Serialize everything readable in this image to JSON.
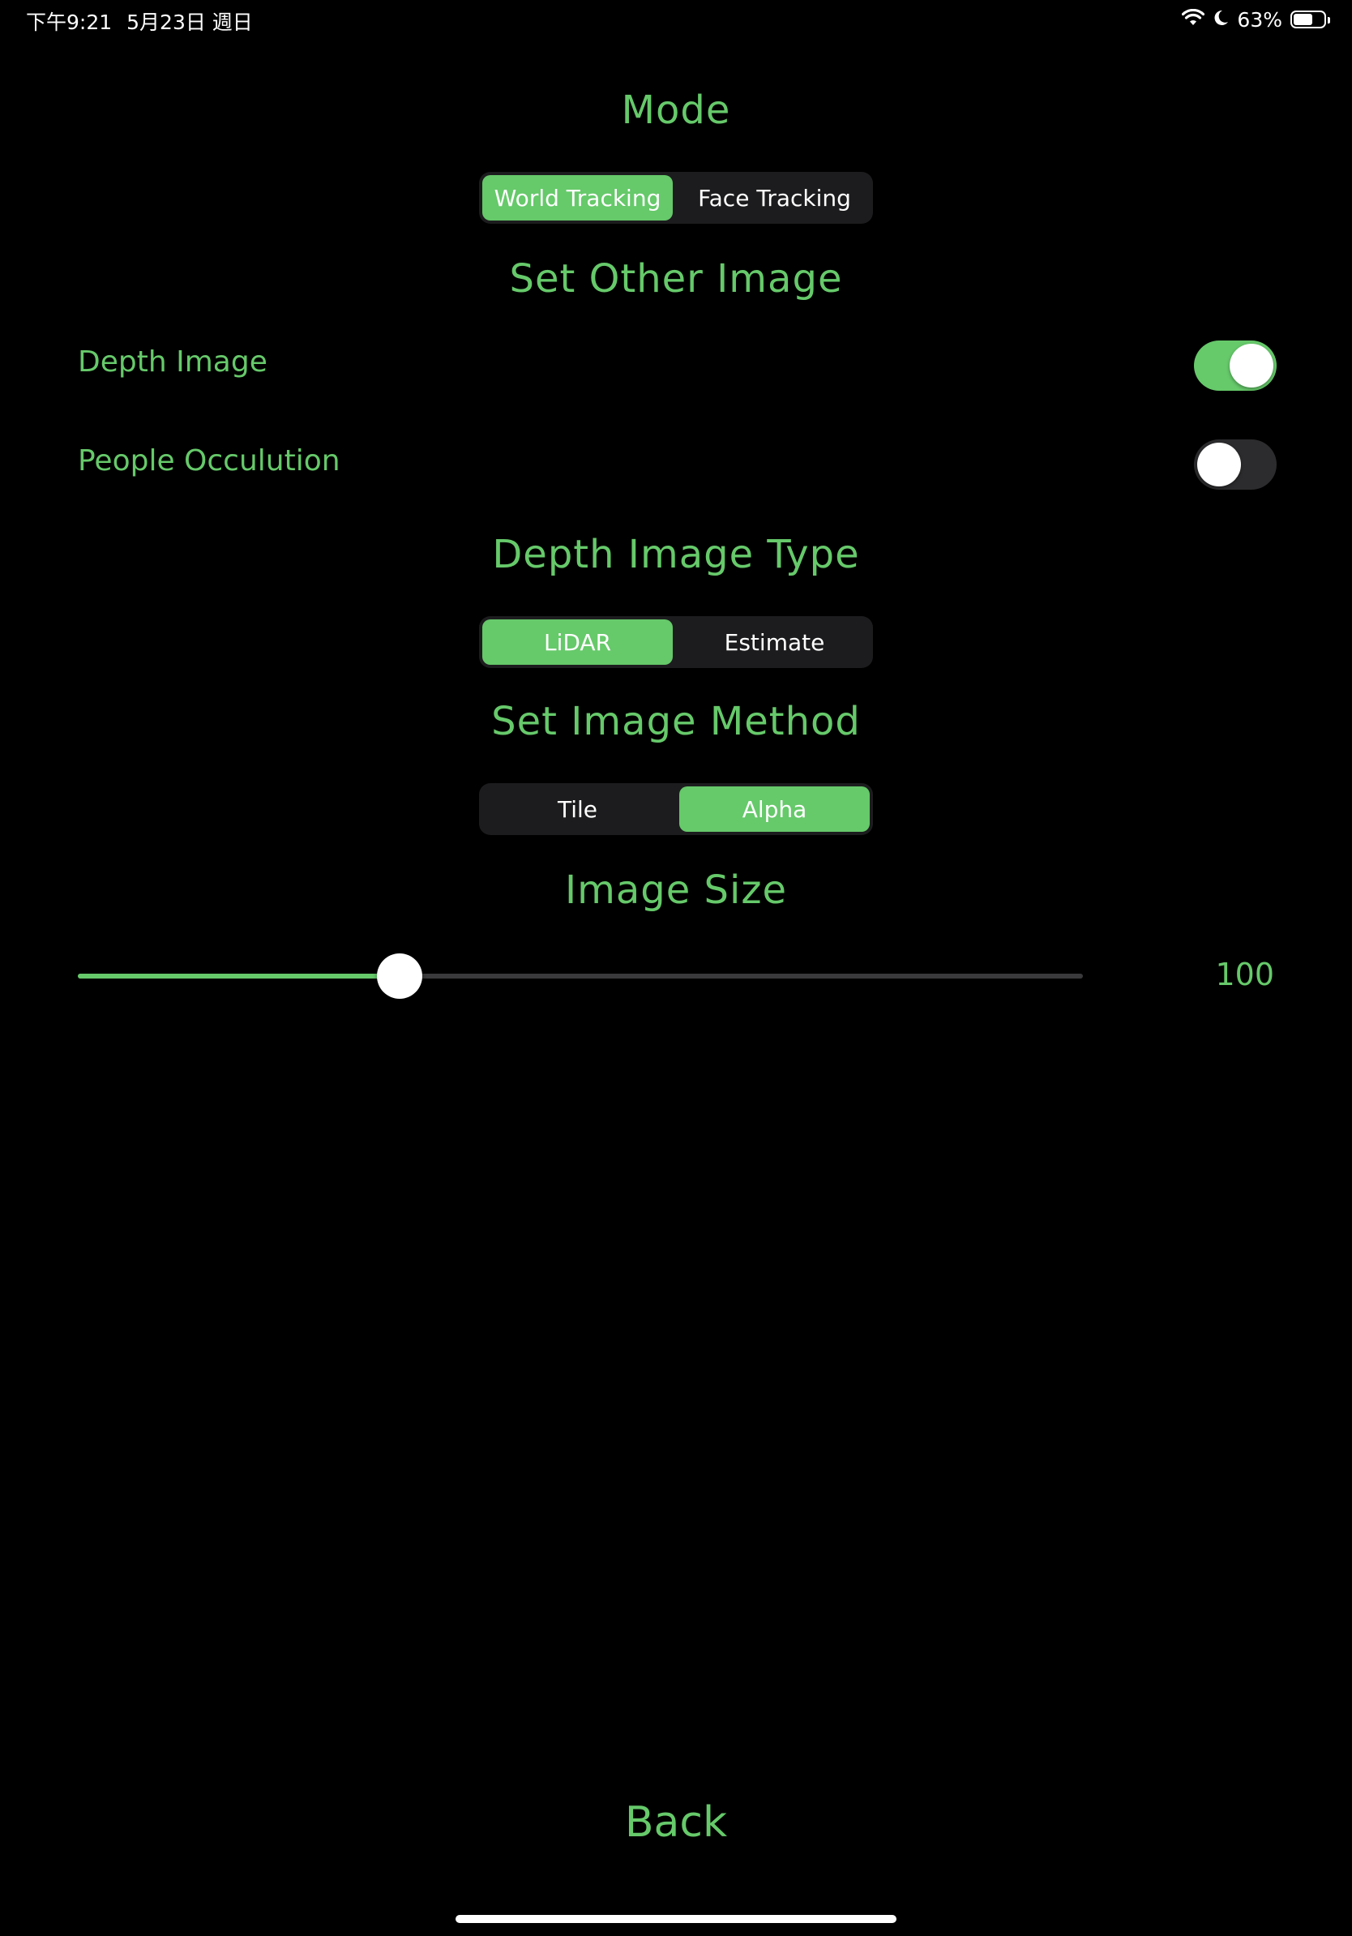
{
  "status_bar": {
    "time": "下午9:21",
    "date": "5月23日 週日",
    "battery_text": "63%",
    "battery_level": 0.63,
    "icons": [
      "wifi-icon",
      "moon-icon",
      "battery-icon"
    ]
  },
  "colors": {
    "accent": "#66c96a",
    "background": "#000000",
    "segment_background": "#1c1c1e",
    "toggle_off": "#2c2c2e"
  },
  "mode": {
    "title": "Mode",
    "options": [
      "World Tracking",
      "Face Tracking"
    ],
    "selected": "World Tracking"
  },
  "other_image": {
    "title": "Set Other Image",
    "depth_image": {
      "label": "Depth Image",
      "on": true
    },
    "people_occlusion": {
      "label": "People Occulution",
      "on": false
    }
  },
  "depth_type": {
    "title": "Depth Image Type",
    "options": [
      "LiDAR",
      "Estimate"
    ],
    "selected": "LiDAR"
  },
  "image_method": {
    "title": "Set Image Method",
    "options": [
      "Tile",
      "Alpha"
    ],
    "selected": "Alpha"
  },
  "image_size": {
    "title": "Image Size",
    "value_text": "100",
    "fraction": 0.32
  },
  "back_label": "Back"
}
